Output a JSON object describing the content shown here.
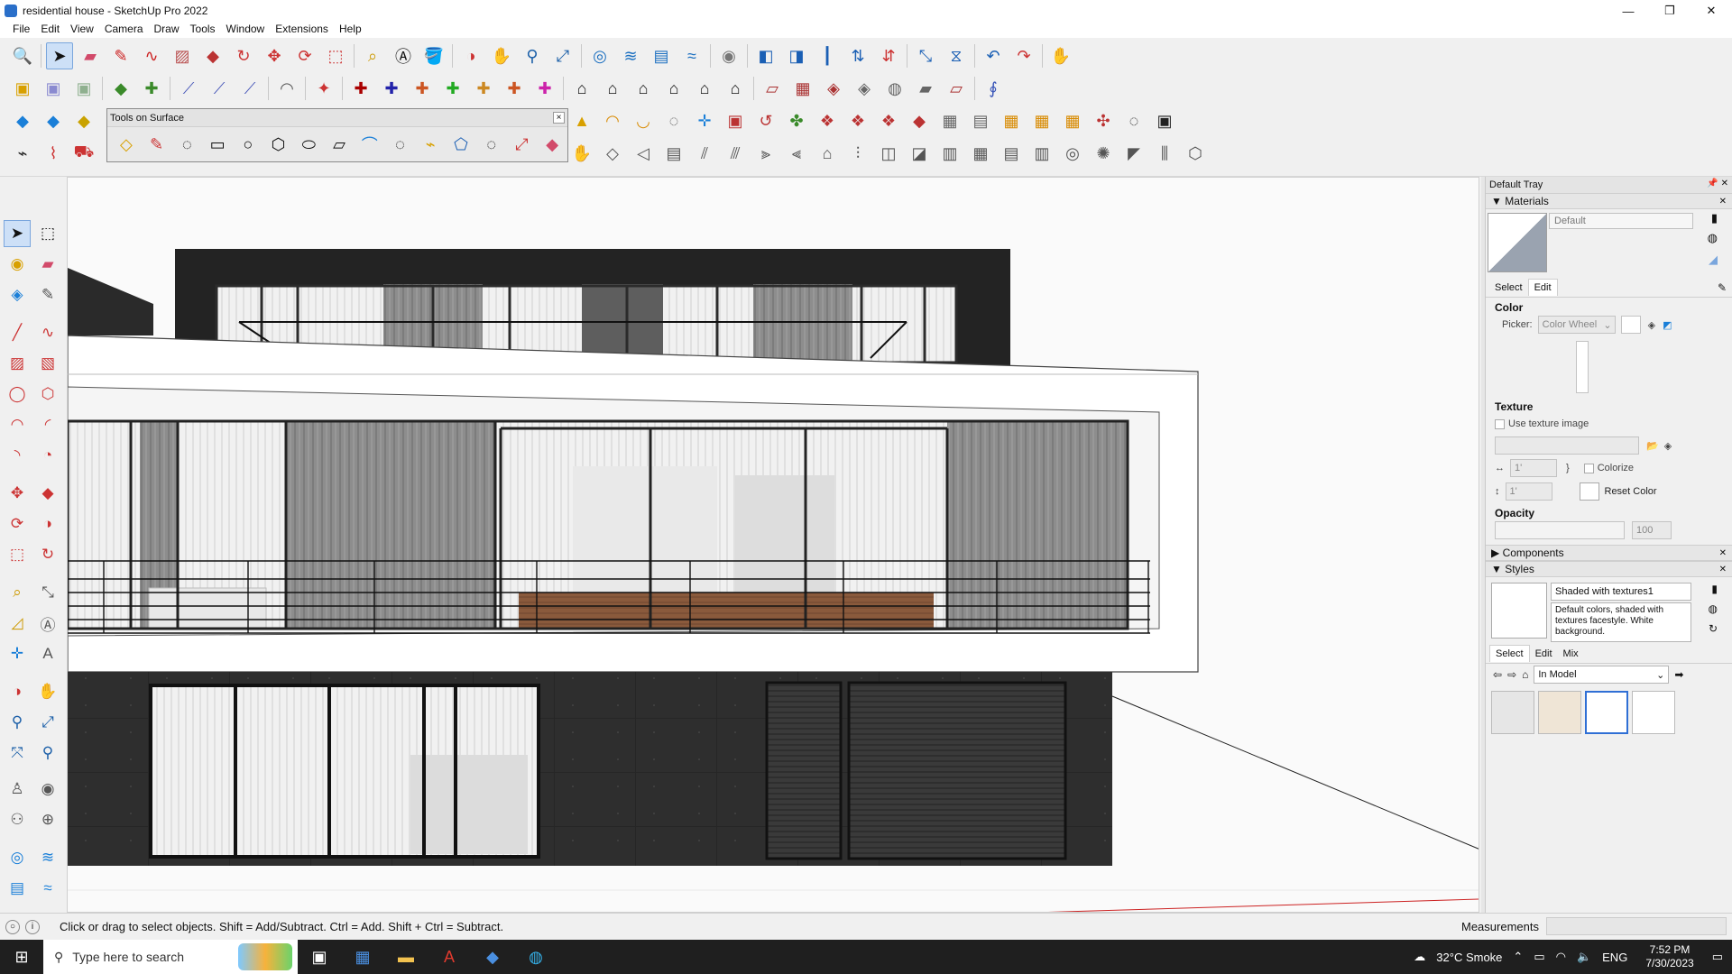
{
  "window": {
    "title": "residential house - SketchUp Pro 2022",
    "controls": [
      "—",
      "❐",
      "✕"
    ]
  },
  "menu": [
    "File",
    "Edit",
    "View",
    "Camera",
    "Draw",
    "Tools",
    "Window",
    "Extensions",
    "Help"
  ],
  "floating_toolbar": {
    "title": "Tools on Surface",
    "close": "×"
  },
  "tray": {
    "title": "Default Tray",
    "materials": {
      "header": "Materials",
      "name": "Default",
      "tabs": [
        "Select",
        "Edit"
      ],
      "color_label": "Color",
      "picker_label": "Picker:",
      "picker_value": "Color Wheel",
      "texture_label": "Texture",
      "use_texture": "Use texture image",
      "width": "1'",
      "height": "1'",
      "colorize": "Colorize",
      "reset_color": "Reset Color",
      "opacity_label": "Opacity",
      "opacity_value": "100"
    },
    "components": {
      "header": "Components"
    },
    "styles": {
      "header": "Styles",
      "name": "Shaded with textures1",
      "description": "Default colors, shaded with textures facestyle. White background.",
      "tabs": [
        "Select",
        "Edit",
        "Mix"
      ],
      "collection": "In Model"
    }
  },
  "status": {
    "hint": "Click or drag to select objects. Shift = Add/Subtract. Ctrl = Add. Shift + Ctrl = Subtract.",
    "measurements_label": "Measurements"
  },
  "taskbar": {
    "search_placeholder": "Type here to search",
    "weather": "32°C Smoke",
    "lang": "ENG",
    "time": "7:52 PM",
    "date": "7/30/2023"
  },
  "colors": {
    "accent": "#2f6fd5",
    "facade_dark": "#2b2b2b",
    "wood_panel": "#8b8b8b",
    "floor_wood": "#8a5a3c"
  }
}
